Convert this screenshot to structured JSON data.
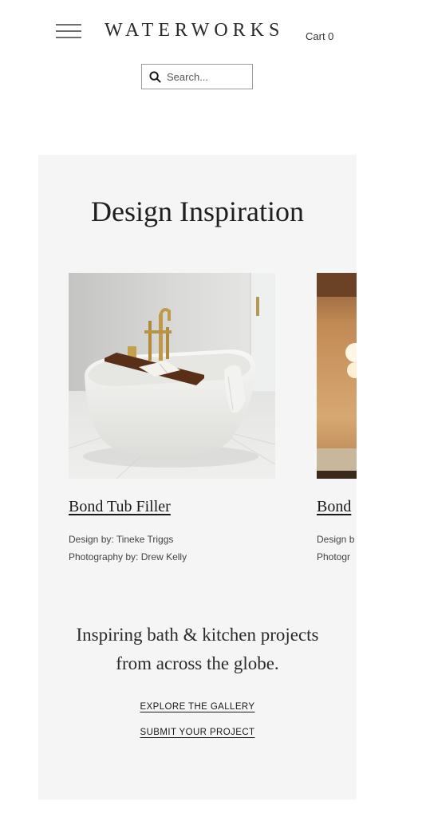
{
  "header": {
    "logo": "WATERWORKS",
    "cart_label": "Cart 0"
  },
  "search": {
    "placeholder": "Search..."
  },
  "section": {
    "title": "Design Inspiration",
    "cards": [
      {
        "title": "Bond Tub Filler",
        "design_by": "Design by: Tineke Triggs",
        "photography_by": "Photography by: Drew Kelly"
      },
      {
        "title": "Bond",
        "design_by": "Design b",
        "photography_by": "Photogr"
      }
    ],
    "tagline_line1": "Inspiring bath & kitchen projects",
    "tagline_line2": "from across the globe.",
    "explore_link": "EXPLORE THE GALLERY",
    "submit_link": "SUBMIT YOUR PROJECT"
  },
  "icons": {
    "menu": "hamburger-menu-icon",
    "search": "search-icon"
  },
  "colors": {
    "panel_background": "#f5f5f5",
    "text": "#1d1d1d"
  }
}
